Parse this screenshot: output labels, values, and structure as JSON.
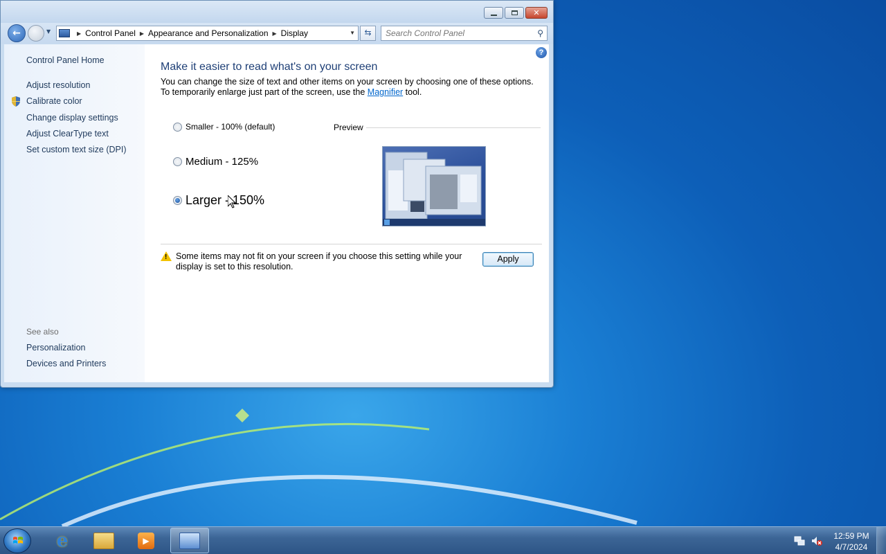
{
  "window": {
    "breadcrumb": [
      "Control Panel",
      "Appearance and Personalization",
      "Display"
    ],
    "search_placeholder": "Search Control Panel"
  },
  "sidebar": {
    "home": "Control Panel Home",
    "links": [
      "Adjust resolution",
      "Calibrate color",
      "Change display settings",
      "Adjust ClearType text",
      "Set custom text size (DPI)"
    ],
    "see_also_heading": "See also",
    "see_also": [
      "Personalization",
      "Devices and Printers"
    ]
  },
  "main": {
    "heading": "Make it easier to read what's on your screen",
    "description_before": "You can change the size of text and other items on your screen by choosing one of these options. To temporarily enlarge just part of the screen, use the ",
    "magnifier_link": "Magnifier",
    "description_after": " tool.",
    "options": [
      {
        "label": "Smaller - 100% (default)",
        "checked": false
      },
      {
        "label": "Medium - 125%",
        "checked": false
      },
      {
        "label": "Larger - 150%",
        "checked": true
      }
    ],
    "preview_label": "Preview",
    "warning": "Some items may not fit on your screen if you choose this setting while your display is set to this resolution.",
    "apply_label": "Apply"
  },
  "taskbar": {
    "pinned": [
      "internet-explorer-icon",
      "windows-explorer-icon",
      "media-player-icon",
      "control-panel-icon"
    ],
    "time": "12:59 PM",
    "date": "4/7/2024"
  },
  "colors": {
    "accent": "#1e3f76",
    "link": "#0066cc",
    "sidebar_link": "#1e395b"
  }
}
